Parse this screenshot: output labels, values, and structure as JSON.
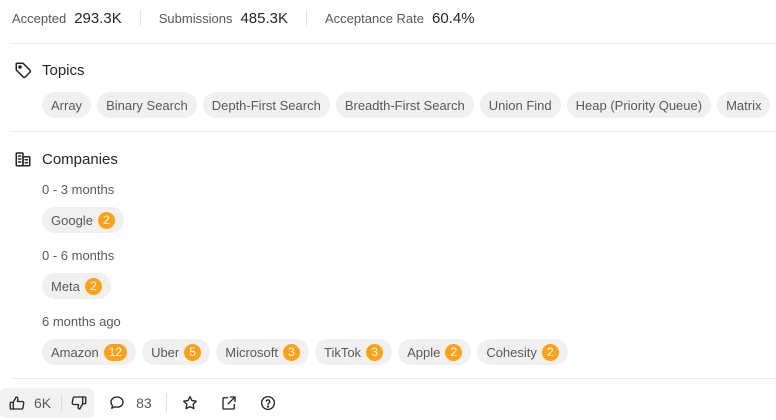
{
  "stats": {
    "accepted_label": "Accepted",
    "accepted_value": "293.3K",
    "submissions_label": "Submissions",
    "submissions_value": "485.3K",
    "acceptance_label": "Acceptance Rate",
    "acceptance_value": "60.4%"
  },
  "topics": {
    "title": "Topics",
    "tags": [
      "Array",
      "Binary Search",
      "Depth-First Search",
      "Breadth-First Search",
      "Union Find",
      "Heap (Priority Queue)",
      "Matrix"
    ]
  },
  "companies": {
    "title": "Companies",
    "groups": [
      {
        "period": "0 - 3 months",
        "companies": [
          {
            "name": "Google",
            "count": "2"
          }
        ]
      },
      {
        "period": "0 - 6 months",
        "companies": [
          {
            "name": "Meta",
            "count": "2"
          }
        ]
      },
      {
        "period": "6 months ago",
        "companies": [
          {
            "name": "Amazon",
            "count": "12"
          },
          {
            "name": "Uber",
            "count": "5"
          },
          {
            "name": "Microsoft",
            "count": "3"
          },
          {
            "name": "TikTok",
            "count": "3"
          },
          {
            "name": "Apple",
            "count": "2"
          },
          {
            "name": "Cohesity",
            "count": "2"
          }
        ]
      }
    ]
  },
  "footer": {
    "likes": "6K",
    "comments": "83"
  },
  "colors": {
    "badge": "#ffa116",
    "chip_bg": "#f0f0f0"
  },
  "icons": {
    "topics": "tag-icon",
    "companies": "building-icon",
    "like": "thumbs-up-icon",
    "dislike": "thumbs-down-icon",
    "comments": "comment-icon",
    "favorite": "star-icon",
    "share": "external-link-icon",
    "help": "question-icon"
  }
}
